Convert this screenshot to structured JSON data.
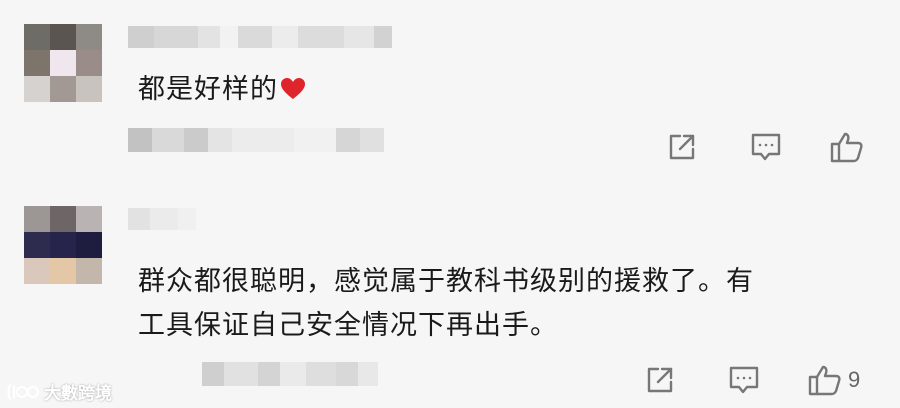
{
  "comments": [
    {
      "text_lines": [
        "都是好样的"
      ],
      "has_heart_emoji": true,
      "like_count": "",
      "actions": [
        "share-icon",
        "reply-icon",
        "like-icon"
      ]
    },
    {
      "text_lines": [
        "群众都很聪明，感觉属于教科书级别的援救了。有",
        "工具保证自己安全情况下再出手。"
      ],
      "has_heart_emoji": false,
      "like_count": "9",
      "actions": [
        "share-icon",
        "reply-icon",
        "like-icon"
      ]
    }
  ],
  "watermark": {
    "text": "大數跨境"
  },
  "colors": {
    "background": "#f6f6f6",
    "heart": "#e0242c",
    "icon": "#777777"
  }
}
